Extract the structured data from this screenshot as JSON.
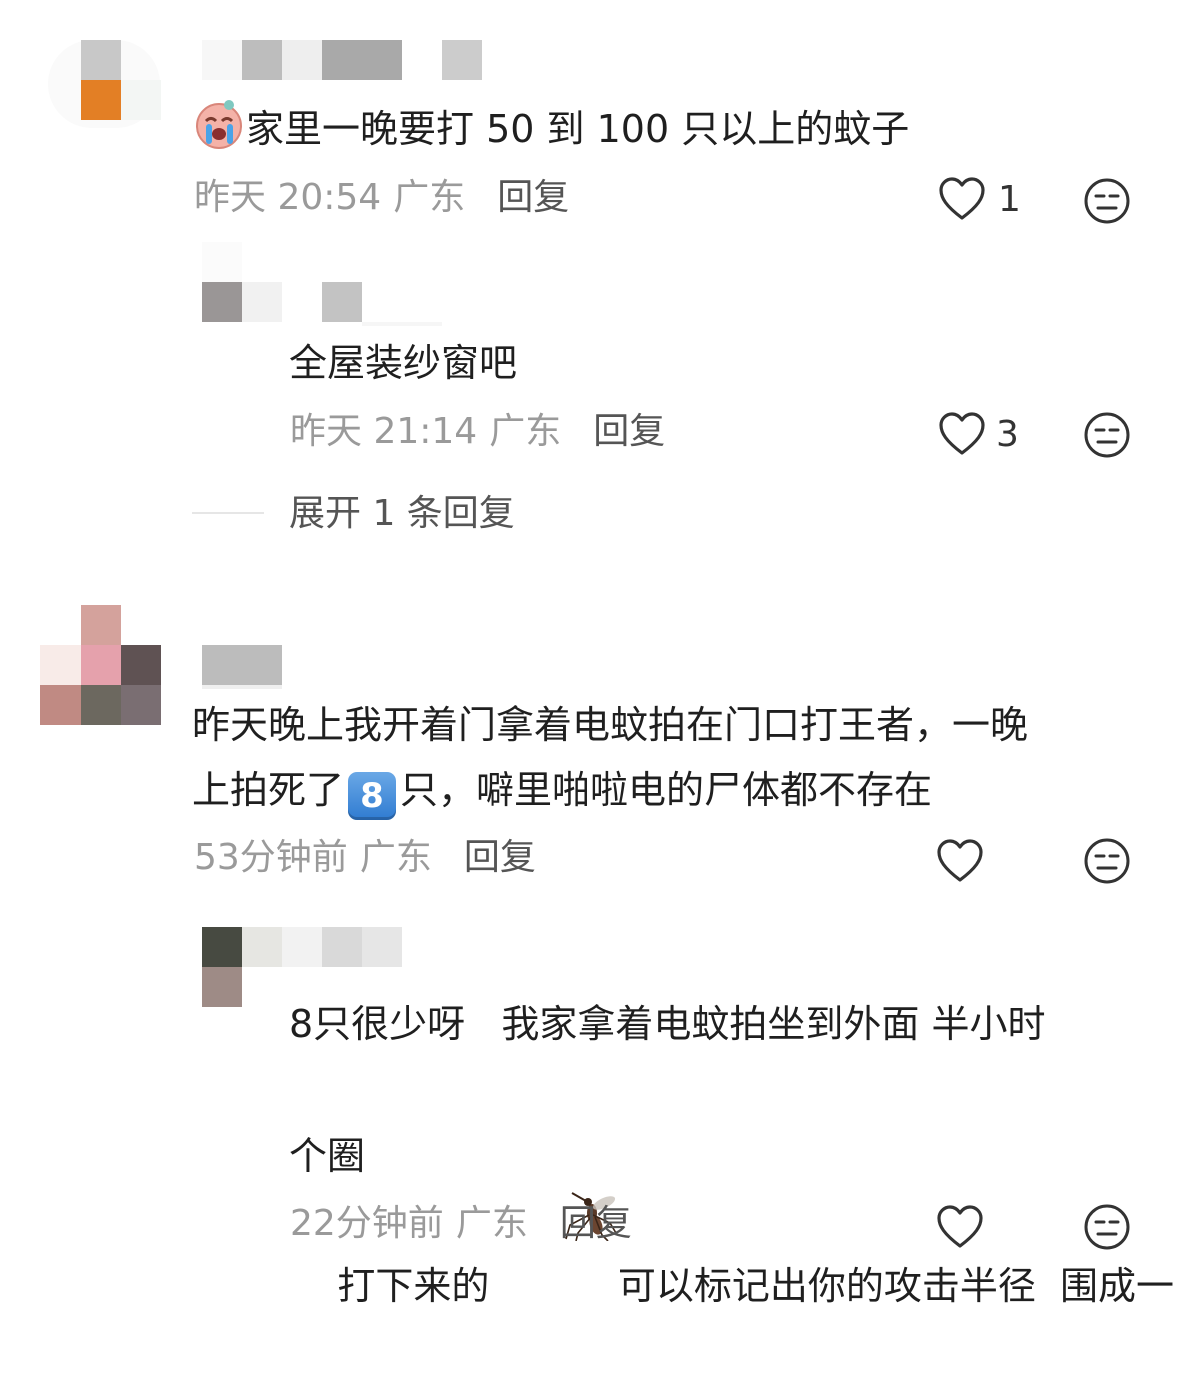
{
  "comments": [
    {
      "text": "家里一晚要打 50 到 100 只以上的蚊子",
      "time": "昨天 20:54",
      "location": "广东",
      "reply_label": "回复",
      "likes": "1",
      "emoji_icon": "crying-face-emoji",
      "replies": [
        {
          "text": "全屋装纱窗吧",
          "time": "昨天 21:14",
          "location": "广东",
          "reply_label": "回复",
          "likes": "3"
        }
      ],
      "expand_label": "展开 1 条回复"
    },
    {
      "text_line1": "昨天晚上我开着门拿着电蚊拍在门口打王者，一晚",
      "text_line2_pre": "上拍死了",
      "keycap": "8",
      "text_line2_post": "只，噼里啪啦电的尸体都不存在",
      "time": "53分钟前",
      "location": "广东",
      "reply_label": "回复",
      "replies": [
        {
          "line1": "8只很少呀   我家拿着电蚊拍坐到外面 半小时",
          "line2_pre": "打下来的",
          "emoji_icon": "mosquito-emoji",
          "line2_post": "可以标记出你的攻击半径  围成一",
          "line3": "个圈",
          "time": "22分钟前",
          "location": "广东",
          "reply_label": "回复"
        }
      ]
    }
  ],
  "colors": {
    "accent_keycap": "#2f7bd1",
    "text_primary": "#1f1f1f",
    "text_meta": "#9a9a9a"
  }
}
